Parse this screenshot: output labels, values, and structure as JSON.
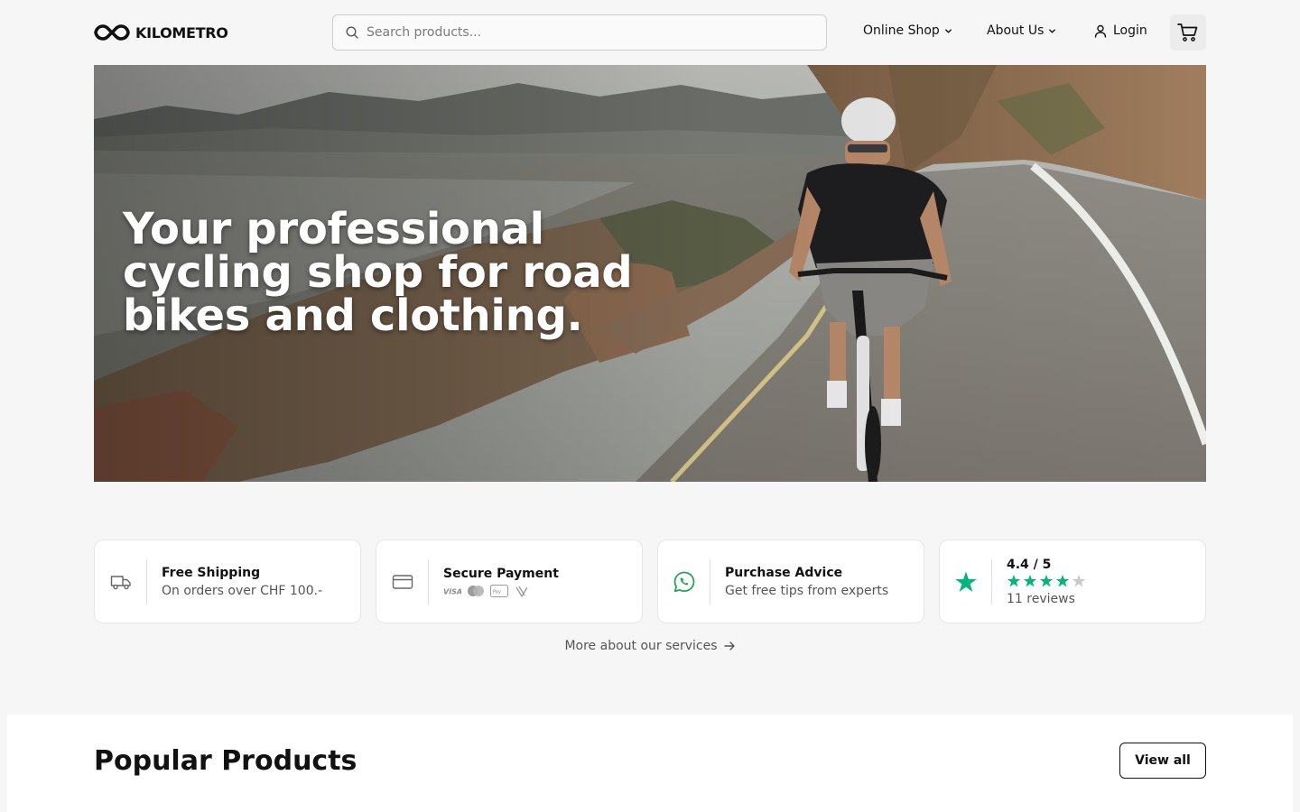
{
  "brand": {
    "name": "KILOMETRO",
    "icon": "infinity-logo-icon"
  },
  "search": {
    "placeholder": "Search products..."
  },
  "nav": {
    "shop_label": "Online Shop",
    "about_label": "About Us",
    "login_label": "Login"
  },
  "hero": {
    "title": "Your professional cycling shop for road bikes and clothing."
  },
  "services": [
    {
      "title": "Free Shipping",
      "subtitle": "On orders over CHF 100.-",
      "icon": "truck-icon"
    },
    {
      "title": "Secure Payment",
      "icon": "credit-card-icon",
      "payment_methods": [
        "VISA",
        "Mastercard",
        "Apple Pay",
        "TWINT"
      ]
    },
    {
      "title": "Purchase Advice",
      "subtitle": "Get free tips from experts",
      "icon": "whatsapp-icon"
    },
    {
      "rating": "4.4 / 5",
      "stars_filled": 4,
      "stars_total": 5,
      "reviews": "11 reviews",
      "icon": "trustpilot-star-icon"
    }
  ],
  "more_services_label": "More about our services",
  "popular": {
    "title": "Popular Products",
    "view_all_label": "View all"
  },
  "colors": {
    "accent_green": "#00b67a",
    "whatsapp_green": "#25a55a",
    "text": "#111111",
    "muted": "#555555"
  }
}
